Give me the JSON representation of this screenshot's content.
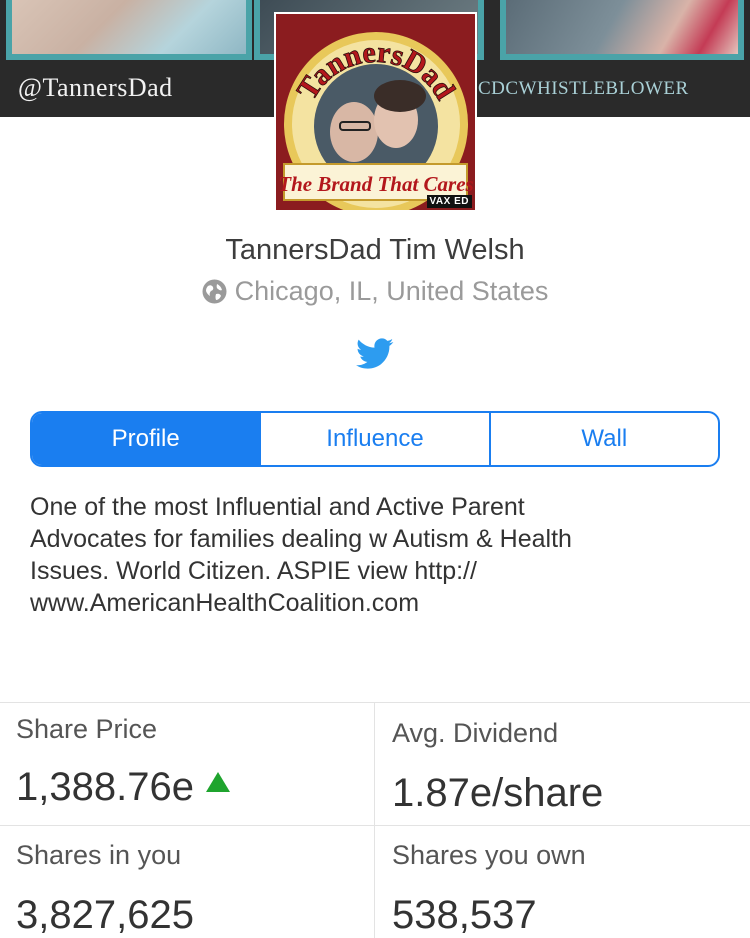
{
  "banner": {
    "handle_left": "@TannersDad",
    "handle_right": "CDCWHISTLEBLOWER"
  },
  "avatar": {
    "arc_text": "TannersDad",
    "tagline": "The Brand That Cares",
    "corner_badge": "VAX ED"
  },
  "profile": {
    "name": "TannersDad Tim Welsh",
    "location": "Chicago, IL, United States"
  },
  "tabs": [
    {
      "label": "Profile",
      "active": true
    },
    {
      "label": "Influence",
      "active": false
    },
    {
      "label": "Wall",
      "active": false
    }
  ],
  "bio": {
    "lines": [
      "One of the most Influential and Active Parent",
      "Advocates for families dealing w Autism & Health",
      "Issues. World Citizen. ASPIE view http://",
      "www.AmericanHealthCoalition.com"
    ]
  },
  "stats": {
    "share_price_label": "Share Price",
    "share_price_value": "1,388.76e",
    "avg_dividend_label": "Avg. Dividend",
    "avg_dividend_value": "1.87e/share",
    "shares_in_you_label": "Shares in you",
    "shares_in_you_value": "3,827,625",
    "shares_you_own_label": "Shares you own",
    "shares_you_own_value": "538,537"
  },
  "colors": {
    "accent": "#1a7ef0",
    "up": "#1fa42e",
    "twitter": "#2d9cf0"
  },
  "icons": {
    "location": "globe-icon",
    "social": "twitter-bird-icon",
    "trend": "up-arrow-icon"
  }
}
